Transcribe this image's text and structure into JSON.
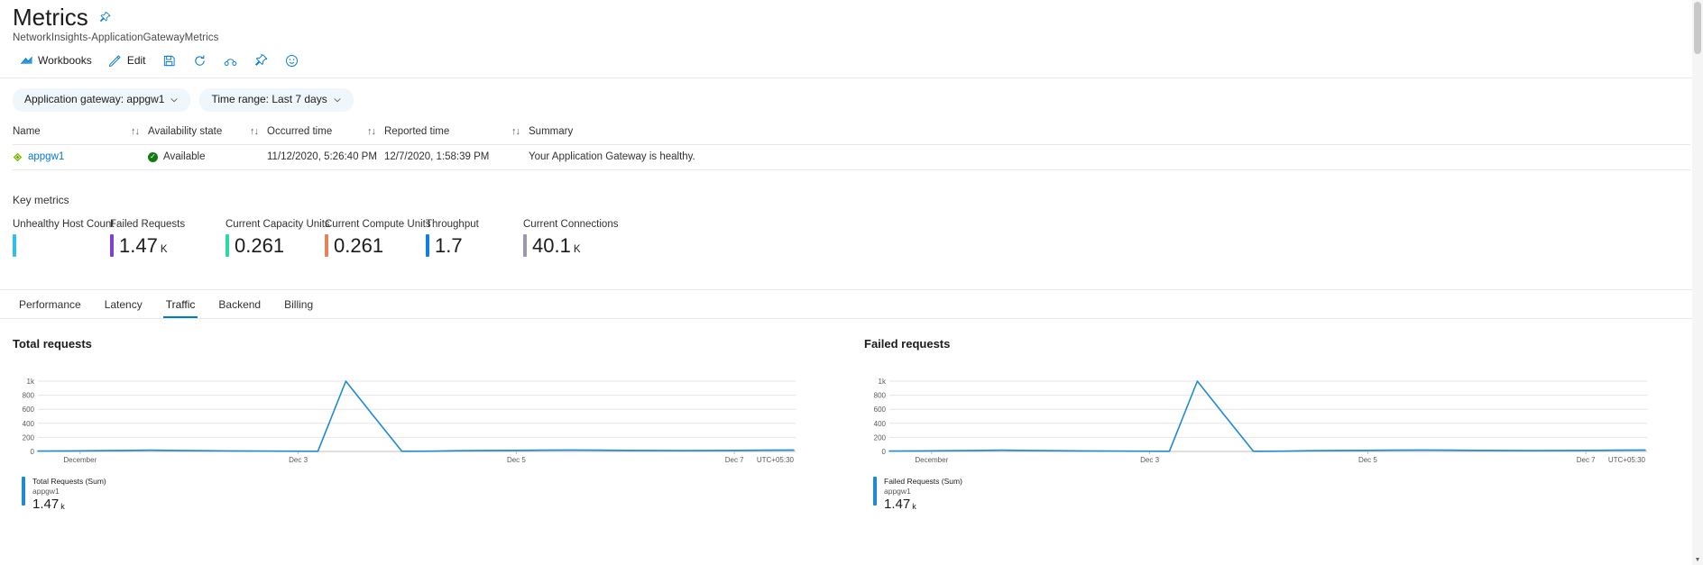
{
  "header": {
    "title": "Metrics",
    "pin_icon": "pin-icon",
    "subtitle": "NetworkInsights-ApplicationGatewayMetrics"
  },
  "toolbar": {
    "items": [
      {
        "label": "Workbooks",
        "icon": "workbooks-icon"
      },
      {
        "label": "Edit",
        "icon": "pencil-icon"
      },
      {
        "label": "",
        "icon": "save-icon"
      },
      {
        "label": "",
        "icon": "refresh-icon"
      },
      {
        "label": "",
        "icon": "share-icon"
      },
      {
        "label": "",
        "icon": "pin-icon"
      },
      {
        "label": "",
        "icon": "feedback-smiley-icon"
      }
    ]
  },
  "filters": [
    {
      "label": "Application gateway: appgw1",
      "name": "application-gateway-filter"
    },
    {
      "label": "Time range: Last 7 days",
      "name": "time-range-filter"
    }
  ],
  "table": {
    "columns": [
      {
        "label": "Name",
        "sortable": true
      },
      {
        "label": "Availability state",
        "sortable": true
      },
      {
        "label": "Occurred time",
        "sortable": true
      },
      {
        "label": "Reported time",
        "sortable": true
      },
      {
        "label": "Summary",
        "sortable": true
      }
    ],
    "sort_glyph": "↑↓",
    "rows": [
      {
        "name": "appgw1",
        "availability_state": "Available",
        "occurred_time": "11/12/2020, 5:26:40 PM",
        "reported_time": "12/7/2020, 1:58:39 PM",
        "summary": "Your Application Gateway is healthy."
      }
    ]
  },
  "key_metrics": {
    "title": "Key metrics",
    "items": [
      {
        "label": "Unhealthy Host Count",
        "value": "",
        "unit": "",
        "color": "#32bfe8"
      },
      {
        "label": "Failed Requests",
        "value": "1.47",
        "unit": "K",
        "color": "#7b45d3"
      },
      {
        "label": "Current Capacity Units",
        "value": "0.261",
        "unit": "",
        "color": "#2ad9a8"
      },
      {
        "label": "Current Compute Units",
        "value": "0.261",
        "unit": "",
        "color": "#e8825a"
      },
      {
        "label": "Throughput",
        "value": "1.7",
        "unit": "",
        "color": "#0f80e0"
      },
      {
        "label": "Current Connections",
        "value": "40.1",
        "unit": "K",
        "color": "#9a9aa8"
      }
    ]
  },
  "tabs": [
    {
      "label": "Performance",
      "active": false
    },
    {
      "label": "Latency",
      "active": false
    },
    {
      "label": "Traffic",
      "active": true
    },
    {
      "label": "Backend",
      "active": false
    },
    {
      "label": "Billing",
      "active": false
    }
  ],
  "chart_data": [
    {
      "type": "line",
      "title": "Total requests",
      "xlabel": "",
      "ylabel": "",
      "ylim": [
        0,
        1000
      ],
      "ytick_labels": [
        "1k",
        "800",
        "600",
        "400",
        "200",
        "0"
      ],
      "ytick_values": [
        1000,
        800,
        600,
        400,
        200,
        0
      ],
      "xtick_labels": [
        "December",
        "Dec 3",
        "Dec 5",
        "Dec 7"
      ],
      "timezone_label": "UTC+05:30",
      "grid": true,
      "legend_position": "bottom-left",
      "series": [
        {
          "name": "Total Requests (Sum)",
          "resource": "appgw1",
          "color": "#1f8ad2",
          "aggregate_value": "1.47",
          "aggregate_unit": "k",
          "x": [
            0,
            1,
            2,
            3,
            4,
            5,
            6,
            7,
            8,
            9,
            10,
            11,
            12,
            13,
            14,
            15,
            16,
            17,
            18,
            19,
            20,
            21,
            22,
            23,
            24,
            25,
            26,
            27
          ],
          "values": [
            6,
            8,
            10,
            14,
            18,
            14,
            10,
            8,
            6,
            4,
            3,
            1000,
            500,
            2,
            4,
            10,
            14,
            16,
            18,
            20,
            18,
            16,
            14,
            12,
            14,
            16,
            18,
            20
          ]
        }
      ]
    },
    {
      "type": "line",
      "title": "Failed requests",
      "xlabel": "",
      "ylabel": "",
      "ylim": [
        0,
        1000
      ],
      "ytick_labels": [
        "1k",
        "800",
        "600",
        "400",
        "200",
        "0"
      ],
      "ytick_values": [
        1000,
        800,
        600,
        400,
        200,
        0
      ],
      "xtick_labels": [
        "December",
        "Dec 3",
        "Dec 5",
        "Dec 7"
      ],
      "timezone_label": "UTC+05:30",
      "grid": true,
      "legend_position": "bottom-left",
      "series": [
        {
          "name": "Failed Requests (Sum)",
          "resource": "appgw1",
          "color": "#1f8ad2",
          "aggregate_value": "1.47",
          "aggregate_unit": "k",
          "x": [
            0,
            1,
            2,
            3,
            4,
            5,
            6,
            7,
            8,
            9,
            10,
            11,
            12,
            13,
            14,
            15,
            16,
            17,
            18,
            19,
            20,
            21,
            22,
            23,
            24,
            25,
            26,
            27
          ],
          "values": [
            6,
            8,
            10,
            14,
            18,
            14,
            10,
            8,
            6,
            4,
            3,
            1000,
            500,
            2,
            4,
            10,
            14,
            16,
            18,
            20,
            18,
            16,
            14,
            12,
            14,
            16,
            18,
            20
          ]
        }
      ]
    }
  ],
  "scrollbar": {
    "up_glyph": "▲",
    "down_glyph": "▼"
  }
}
